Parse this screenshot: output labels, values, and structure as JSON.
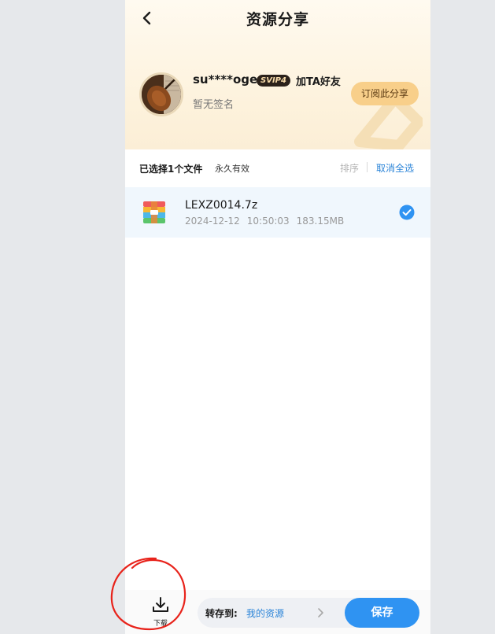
{
  "header": {
    "title": "资源分享"
  },
  "sharer": {
    "username": "su****oge",
    "badge": "SVIP4",
    "add_friend": "加TA好友",
    "signature": "暂无签名",
    "subscribe_label": "订阅此分享"
  },
  "selection": {
    "selected_text": "已选择1个文件",
    "validity": "永久有效",
    "sort_label": "排序",
    "cancel_all_label": "取消全选"
  },
  "files": [
    {
      "name": "LEXZ0014.7z",
      "date": "2024-12-12",
      "time": "10:50:03",
      "size": "183.15MB",
      "checked": true
    }
  ],
  "bottom": {
    "download_label": "下载",
    "save_to_label": "转存到:",
    "save_to_target": "我的资源",
    "save_label": "保存"
  },
  "colors": {
    "accent": "#2f93f2",
    "link": "#2b84d8",
    "subscribe_bg": "#f8cf8a",
    "annotation": "#e8231b"
  }
}
